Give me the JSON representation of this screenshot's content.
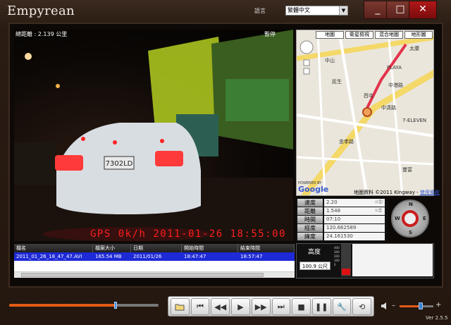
{
  "app": {
    "title": "Empyrean",
    "language_label": "語言",
    "language_value": "繁體中文",
    "version": "Ver 2.5.5"
  },
  "window_buttons": {
    "minimize": "_",
    "maximize": "□",
    "close": "✕"
  },
  "video": {
    "distance_label": "總距離 : 2.139 公里",
    "status": "暫停",
    "osd": "GPS  0k/h  2011-01-26  18:55:00",
    "plate": "7302LD"
  },
  "file_list": {
    "columns": [
      "檔名",
      "檔案大小",
      "日期",
      "開始時間",
      "結束時間"
    ],
    "rows": [
      [
        "2011_01_26_18_47_47.AVI",
        "165.54 MB",
        "2011/01/26",
        "18:47:47",
        "18:57:47"
      ]
    ]
  },
  "map": {
    "tabs": [
      "地圖",
      "衛星檢視",
      "混合地圖",
      "地形圖"
    ],
    "credit": "地圖資料 ©2011 Kingway -",
    "terms_link": "使用條款",
    "powered": "POWERED BY",
    "google": "Google",
    "labels": [
      "太康",
      "中山",
      "民生",
      "西屯",
      "PLAYA",
      "7-ELEVEN",
      "中港路",
      "忠孝路",
      "豐富",
      "中清路"
    ]
  },
  "stats": [
    {
      "label": "速度",
      "value": "2.20",
      "unit": "公里/小時"
    },
    {
      "label": "距離",
      "value": "1.548",
      "unit": "公里"
    },
    {
      "label": "時間",
      "value": "07:10",
      "unit": ""
    },
    {
      "label": "經度",
      "value": "120.662589",
      "unit": ""
    },
    {
      "label": "緯度",
      "value": "24.161530",
      "unit": ""
    }
  ],
  "compass": {
    "n": "N",
    "s": "S",
    "e": "E",
    "w": "W"
  },
  "altitude": {
    "label": "高度",
    "value": "100.9 公尺",
    "ticks": [
      "400",
      "300",
      "200",
      "100",
      "0"
    ],
    "level": 0.22
  },
  "playback": {
    "progress": 0.71,
    "volume": 0.62
  },
  "controls": [
    "open-folder",
    "first",
    "rewind",
    "play",
    "fast-forward",
    "last",
    "stop",
    "pause",
    "settings",
    "repeat"
  ]
}
